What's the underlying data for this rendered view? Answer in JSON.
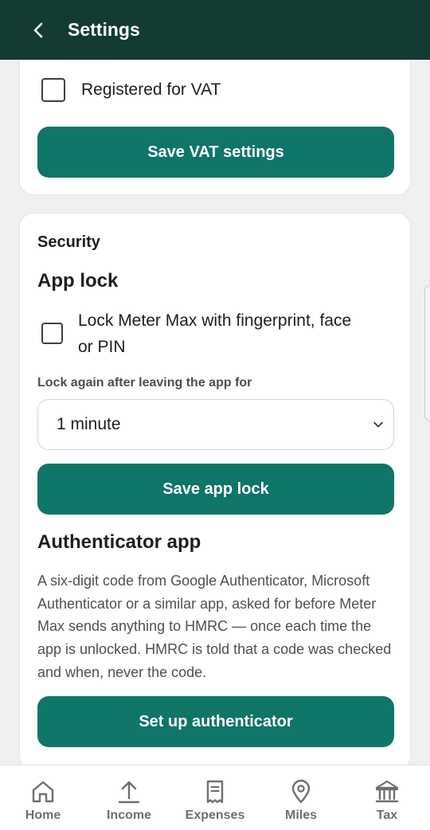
{
  "app_bar": {
    "title": "Settings"
  },
  "vat": {
    "checkbox_label": "Registered for VAT",
    "save_label": "Save VAT settings"
  },
  "security": {
    "section_label": "Security",
    "app_lock": {
      "heading": "App lock",
      "checkbox_label_line1": "Lock Meter Max with fingerprint, face",
      "checkbox_label_line2": "or PIN",
      "timeout_label": "Lock again after leaving the app for",
      "timeout_value": "1 minute",
      "save_label": "Save app lock"
    },
    "authenticator": {
      "heading": "Authenticator app",
      "description": "A six-digit code from Google Authenticator, Microsoft Authenticator or a similar app, asked for before Meter Max sends anything to HMRC — once each time the app is unlocked. HMRC is told that a code was checked and when, never the code.",
      "setup_label": "Set up authenticator"
    }
  },
  "bottom_nav": {
    "items": [
      {
        "label": "Home",
        "icon": "home-icon"
      },
      {
        "label": "Income",
        "icon": "upload-icon"
      },
      {
        "label": "Expenses",
        "icon": "receipt-icon"
      },
      {
        "label": "Miles",
        "icon": "location-pin-icon"
      },
      {
        "label": "Tax",
        "icon": "bank-icon"
      }
    ]
  },
  "colors": {
    "app_bar": "#123b33",
    "primary_button": "#0f7567",
    "background": "#eef0ef"
  }
}
